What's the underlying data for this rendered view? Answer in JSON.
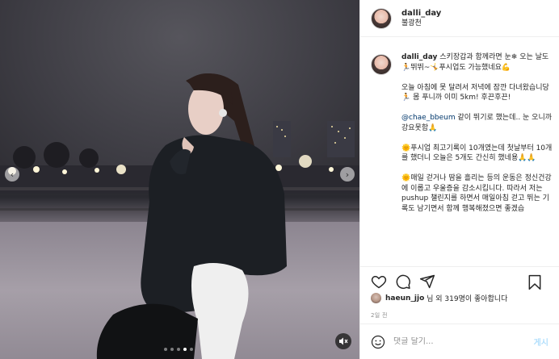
{
  "post": {
    "username": "dalli_day",
    "location": "불광천",
    "caption": {
      "lines": [
        "스키장갑과 함께라면 눈❄ 오는 날도 🏃뛰뛰~🤸푸시업도 가능했네요💪",
        "오늘 아침에 못 달려서 저녁에 잠깐 다녀왔습니당🏃 몸 푸니까 이미 5km! 후끈후끈!",
        "@chae_bbeum 같이 뛰기로 했는데.. 눈 오니까 강요못함🙏",
        "🌞푸시업 최고기록이 10개였는데 첫날부터 10개를 했더니 오늘은 5개도 간신히 했네용🙏🙏",
        "🌞매일 걷거나 땀을 흘리는 등의 운동은 정신건강에 이롭고 우울증을 감소시킵니다. 따라서 저는 pushup 챌린지를 하면서 매일아침 걷고 뛰는 기록도 남기면서 함께 행복해졌으면 좋겠습"
      ],
      "mention": "@chae_bbeum",
      "line3_rest": " 같이 뛰기로 했는데.. 눈 오니까 강요못함🙏"
    },
    "likes": {
      "liker": "haeun_jjo",
      "suffix": "님 외 319명이 좋아합니다"
    },
    "time": "2일 전",
    "comment_placeholder": "댓글 달기...",
    "post_label": "게시"
  },
  "media": {
    "dots_total": 5,
    "dots_active": 4
  },
  "icons": [
    "chevron-left-icon",
    "chevron-right-icon",
    "audio-muted-icon",
    "heart-icon",
    "comment-icon",
    "share-icon",
    "bookmark-icon",
    "emoji-icon"
  ],
  "colors": {
    "link": "#00376b",
    "post_disabled": "#b2dffc",
    "muted": "#8e8e8e"
  }
}
